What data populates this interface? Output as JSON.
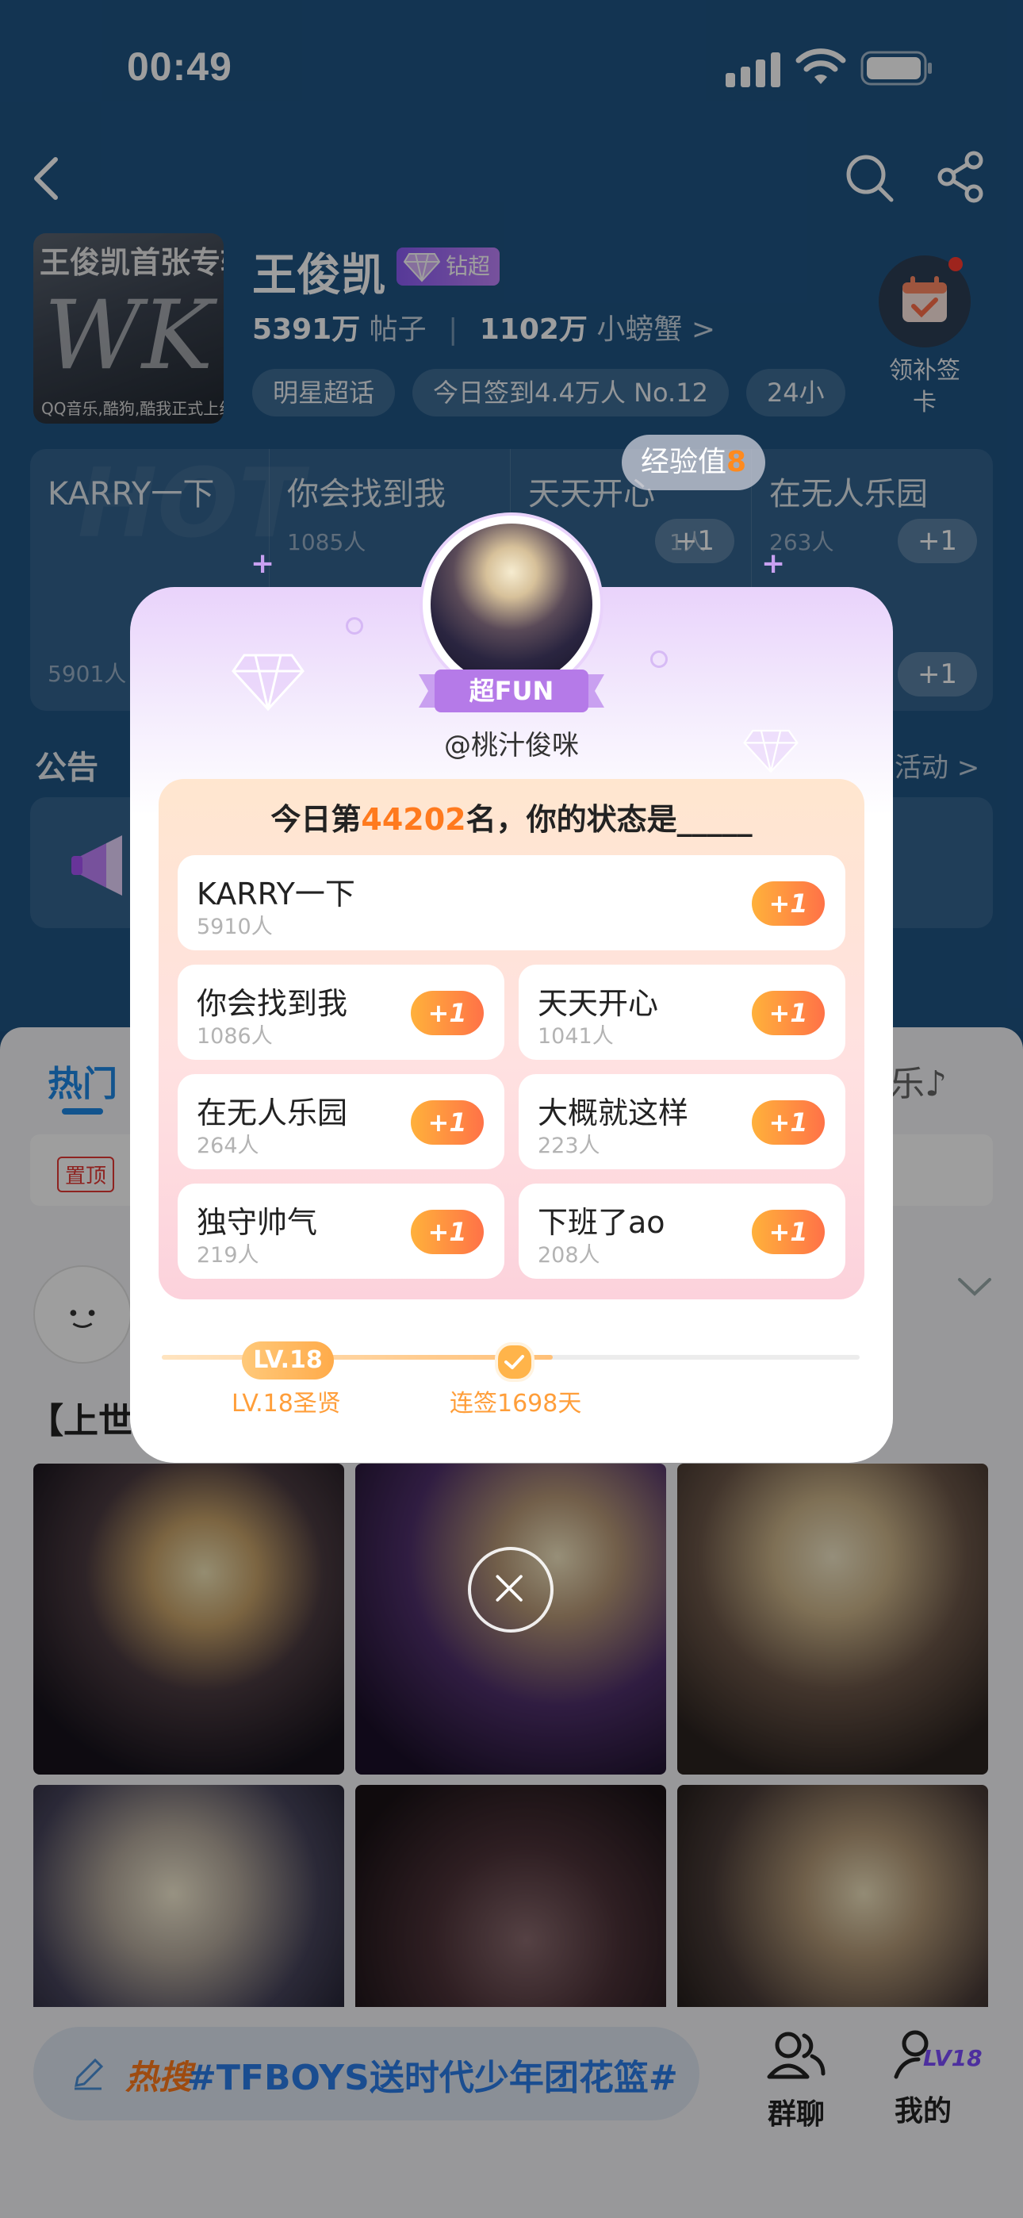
{
  "status_bar": {
    "time": "00:49"
  },
  "header": {
    "album_title": "王俊凯首张专辑",
    "album_art_text": "WK",
    "album_subtitle": "QQ音乐,酷狗,酷我正式上线",
    "star_name": "王俊凯",
    "badge_label": "钻超",
    "posts_count": "5391万",
    "posts_label": "帖子",
    "fans_count": "1102万",
    "fans_label": "小螃蟹 >",
    "tags": [
      "明星超话",
      "今日签到4.4万人 No.12",
      "24小"
    ],
    "checkin_label": "领补签卡"
  },
  "background_grid": {
    "watermark": "HOT",
    "cells": [
      {
        "name": "KARRY一下",
        "count": "5901人"
      },
      {
        "name": "你会找到我",
        "count": "1085人"
      },
      {
        "name": "天天开心",
        "count": "1人"
      },
      {
        "name": "在无人乐园",
        "count": "263人"
      }
    ],
    "plus": "+1"
  },
  "notice": {
    "label": "公告",
    "more": "活动 >"
  },
  "feed": {
    "tab_hot": "热门",
    "tab_music": "乐♪",
    "pin_badge": "置顶",
    "post_title": "【上世"
  },
  "bottom_bar": {
    "hot_label": "热搜",
    "hot_topic": "#TFBOYS送时代少年团花篮#",
    "group_chat": "群聊",
    "mine": "我的",
    "level_badge": "LV18"
  },
  "modal": {
    "exp_label": "经验值",
    "exp_value": "8",
    "fun_badge": "超FUN",
    "handle": "@桃汁俊咪",
    "rank_prefix": "今日第",
    "rank_number": "44202",
    "rank_suffix": "名，你的状态是_____",
    "options": [
      {
        "name": "KARRY一下",
        "count": "5910人",
        "button": "+1"
      },
      {
        "name": "你会找到我",
        "count": "1086人",
        "button": "+1"
      },
      {
        "name": "天天开心",
        "count": "1041人",
        "button": "+1"
      },
      {
        "name": "在无人乐园",
        "count": "264人",
        "button": "+1"
      },
      {
        "name": "大概就这样",
        "count": "223人",
        "button": "+1"
      },
      {
        "name": "独守帅气",
        "count": "219人",
        "button": "+1"
      },
      {
        "name": "下班了ao",
        "count": "208人",
        "button": "+1"
      }
    ],
    "level_pill": "LV.18",
    "level_caption": "LV.18圣贤",
    "streak_caption": "连签1698天",
    "progress": 0.56
  },
  "colors": {
    "accent_orange": "#ff7a1e",
    "accent_blue": "#1e88e5",
    "header_bg": "#1f5484"
  }
}
